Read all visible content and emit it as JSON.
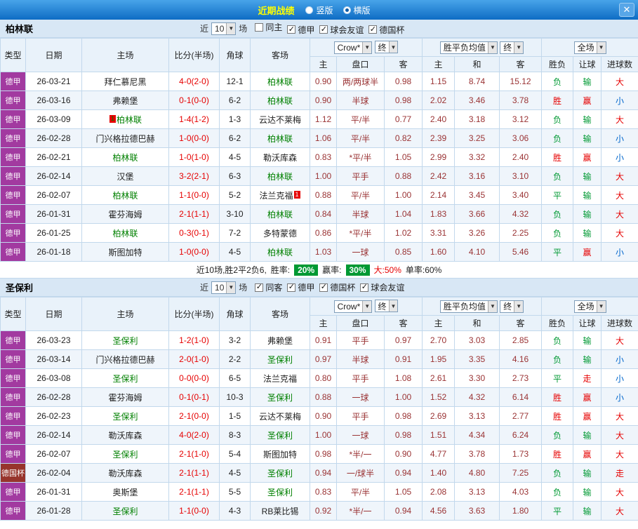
{
  "titlebar": {
    "title": "近期战绩",
    "radios": [
      {
        "label": "竖版",
        "selected": false
      },
      {
        "label": "横版",
        "selected": true
      }
    ],
    "close_label": "✕"
  },
  "table_headers": {
    "type": "类型",
    "date": "日期",
    "home": "主场",
    "score": "比分(半场)",
    "corner": "角球",
    "away": "客场",
    "sub": [
      "主",
      "盘口",
      "客",
      "主",
      "和",
      "客",
      "胜负",
      "让球",
      "进球数"
    ]
  },
  "colors": {
    "titlebar_blue": "#0e6cc4",
    "title_yellow": "#ffff00",
    "band_bg": "#d8e7f5",
    "header_bg": "#e9f2fa",
    "grid_line": "#c2d8ec",
    "league_bundesliga_bg": "#a23aa0",
    "league_dfb_pokal_bg": "#97342c",
    "focus_team_green": "#008000",
    "score_red": "#e60000",
    "odds_maroon": "#9a3334",
    "result_win_red": "#e60000",
    "result_lose_green": "#009933",
    "result_small_blue": "#0066cc",
    "rate_badge_green": "#009933"
  },
  "sections": [
    {
      "team": "柏林联",
      "filter": {
        "prefix": "近",
        "count": "10",
        "suffix": "场",
        "checkboxes": [
          {
            "label": "同主",
            "checked": false
          },
          {
            "label": "德甲",
            "checked": true
          },
          {
            "label": "球会友谊",
            "checked": true
          },
          {
            "label": "德国杯",
            "checked": true
          }
        ]
      },
      "dropdowns": [
        {
          "label": "Crow*"
        },
        {
          "label": "终"
        },
        {
          "label": "胜平负均值"
        },
        {
          "label": "终"
        },
        {
          "label": "全场"
        }
      ],
      "rows": [
        {
          "type": "德甲",
          "date": "26-03-21",
          "home": "拜仁慕尼黑",
          "home_focus": false,
          "score": "4-0(2-0)",
          "corner": "12-1",
          "away": "柏林联",
          "away_focus": true,
          "odds_home": "0.90",
          "handicap": "两/两球半",
          "odds_away": "0.98",
          "avg_home": "1.15",
          "avg_draw": "8.74",
          "avg_away": "15.12",
          "res_wdl": "负",
          "res_handicap": "输",
          "res_goals": "大"
        },
        {
          "type": "德甲",
          "date": "26-03-16",
          "home": "弗赖堡",
          "home_focus": false,
          "score": "0-1(0-0)",
          "corner": "6-2",
          "away": "柏林联",
          "away_focus": true,
          "odds_home": "0.90",
          "handicap": "半球",
          "odds_away": "0.98",
          "avg_home": "2.02",
          "avg_draw": "3.46",
          "avg_away": "3.78",
          "res_wdl": "胜",
          "res_handicap": "赢",
          "res_goals": "小"
        },
        {
          "type": "德甲",
          "date": "26-03-09",
          "home": "柏林联",
          "home_focus": true,
          "home_badge": "1",
          "score": "1-4(1-2)",
          "corner": "1-3",
          "away": "云达不莱梅",
          "away_focus": false,
          "odds_home": "1.12",
          "handicap": "平/半",
          "odds_away": "0.77",
          "avg_home": "2.40",
          "avg_draw": "3.18",
          "avg_away": "3.12",
          "res_wdl": "负",
          "res_handicap": "输",
          "res_goals": "大"
        },
        {
          "type": "德甲",
          "date": "26-02-28",
          "home": "门兴格拉德巴赫",
          "home_focus": false,
          "score": "1-0(0-0)",
          "corner": "6-2",
          "away": "柏林联",
          "away_focus": true,
          "odds_home": "1.06",
          "handicap": "平/半",
          "odds_away": "0.82",
          "avg_home": "2.39",
          "avg_draw": "3.25",
          "avg_away": "3.06",
          "res_wdl": "负",
          "res_handicap": "输",
          "res_goals": "小"
        },
        {
          "type": "德甲",
          "date": "26-02-21",
          "home": "柏林联",
          "home_focus": true,
          "score": "1-0(1-0)",
          "corner": "4-5",
          "away": "勒沃库森",
          "away_focus": false,
          "odds_home": "0.83",
          "handicap": "*平/半",
          "odds_away": "1.05",
          "avg_home": "2.99",
          "avg_draw": "3.32",
          "avg_away": "2.40",
          "res_wdl": "胜",
          "res_handicap": "赢",
          "res_goals": "小"
        },
        {
          "type": "德甲",
          "date": "26-02-14",
          "home": "汉堡",
          "home_focus": false,
          "score": "3-2(2-1)",
          "corner": "6-3",
          "away": "柏林联",
          "away_focus": true,
          "odds_home": "1.00",
          "handicap": "平手",
          "odds_away": "0.88",
          "avg_home": "2.42",
          "avg_draw": "3.16",
          "avg_away": "3.10",
          "res_wdl": "负",
          "res_handicap": "输",
          "res_goals": "大"
        },
        {
          "type": "德甲",
          "date": "26-02-07",
          "home": "柏林联",
          "home_focus": true,
          "score": "1-1(0-0)",
          "corner": "5-2",
          "away": "法兰克福",
          "away_focus": false,
          "away_badge": "1",
          "odds_home": "0.88",
          "handicap": "平/半",
          "odds_away": "1.00",
          "avg_home": "2.14",
          "avg_draw": "3.45",
          "avg_away": "3.40",
          "res_wdl": "平",
          "res_handicap": "输",
          "res_goals": "大"
        },
        {
          "type": "德甲",
          "date": "26-01-31",
          "home": "霍芬海姆",
          "home_focus": false,
          "score": "2-1(1-1)",
          "corner": "3-10",
          "away": "柏林联",
          "away_focus": true,
          "odds_home": "0.84",
          "handicap": "半球",
          "odds_away": "1.04",
          "avg_home": "1.83",
          "avg_draw": "3.66",
          "avg_away": "4.32",
          "res_wdl": "负",
          "res_handicap": "输",
          "res_goals": "大"
        },
        {
          "type": "德甲",
          "date": "26-01-25",
          "home": "柏林联",
          "home_focus": true,
          "score": "0-3(0-1)",
          "corner": "7-2",
          "away": "多特蒙德",
          "away_focus": false,
          "odds_home": "0.86",
          "handicap": "*平/半",
          "odds_away": "1.02",
          "avg_home": "3.31",
          "avg_draw": "3.26",
          "avg_away": "2.25",
          "res_wdl": "负",
          "res_handicap": "输",
          "res_goals": "大"
        },
        {
          "type": "德甲",
          "date": "26-01-18",
          "home": "斯图加特",
          "home_focus": false,
          "score": "1-0(0-0)",
          "corner": "4-5",
          "away": "柏林联",
          "away_focus": true,
          "odds_home": "1.03",
          "handicap": "一球",
          "odds_away": "0.85",
          "avg_home": "1.60",
          "avg_draw": "4.10",
          "avg_away": "5.46",
          "res_wdl": "平",
          "res_handicap": "赢",
          "res_goals": "小"
        }
      ],
      "summary": {
        "record": "近10场,胜2平2负6,",
        "win_rate_label": "胜率:",
        "win_rate": "20%",
        "asian_label": "赢率:",
        "asian_rate": "30%",
        "big_text": "大:50%",
        "single_text": "单率:60%"
      }
    },
    {
      "team": "圣保利",
      "filter": {
        "prefix": "近",
        "count": "10",
        "suffix": "场",
        "checkboxes": [
          {
            "label": "同客",
            "checked": true
          },
          {
            "label": "德甲",
            "checked": true
          },
          {
            "label": "德国杯",
            "checked": true
          },
          {
            "label": "球会友谊",
            "checked": true
          }
        ]
      },
      "dropdowns": [
        {
          "label": "Crow*"
        },
        {
          "label": "终"
        },
        {
          "label": "胜平负均值"
        },
        {
          "label": "终"
        },
        {
          "label": "全场"
        }
      ],
      "rows": [
        {
          "type": "德甲",
          "date": "26-03-23",
          "home": "圣保利",
          "home_focus": true,
          "score": "1-2(1-0)",
          "corner": "3-2",
          "away": "弗赖堡",
          "away_focus": false,
          "odds_home": "0.91",
          "handicap": "平手",
          "odds_away": "0.97",
          "avg_home": "2.70",
          "avg_draw": "3.03",
          "avg_away": "2.85",
          "res_wdl": "负",
          "res_handicap": "输",
          "res_goals": "大"
        },
        {
          "type": "德甲",
          "date": "26-03-14",
          "home": "门兴格拉德巴赫",
          "home_focus": false,
          "score": "2-0(1-0)",
          "corner": "2-2",
          "away": "圣保利",
          "away_focus": true,
          "odds_home": "0.97",
          "handicap": "半球",
          "odds_away": "0.91",
          "avg_home": "1.95",
          "avg_draw": "3.35",
          "avg_away": "4.16",
          "res_wdl": "负",
          "res_handicap": "输",
          "res_goals": "小"
        },
        {
          "type": "德甲",
          "date": "26-03-08",
          "home": "圣保利",
          "home_focus": true,
          "score": "0-0(0-0)",
          "corner": "6-5",
          "away": "法兰克福",
          "away_focus": false,
          "odds_home": "0.80",
          "handicap": "平手",
          "odds_away": "1.08",
          "avg_home": "2.61",
          "avg_draw": "3.30",
          "avg_away": "2.73",
          "res_wdl": "平",
          "res_handicap": "走",
          "res_goals": "小"
        },
        {
          "type": "德甲",
          "date": "26-02-28",
          "home": "霍芬海姆",
          "home_focus": false,
          "score": "0-1(0-1)",
          "corner": "10-3",
          "away": "圣保利",
          "away_focus": true,
          "odds_home": "0.88",
          "handicap": "一球",
          "odds_away": "1.00",
          "avg_home": "1.52",
          "avg_draw": "4.32",
          "avg_away": "6.14",
          "res_wdl": "胜",
          "res_handicap": "赢",
          "res_goals": "小"
        },
        {
          "type": "德甲",
          "date": "26-02-23",
          "home": "圣保利",
          "home_focus": true,
          "score": "2-1(0-0)",
          "corner": "1-5",
          "away": "云达不莱梅",
          "away_focus": false,
          "odds_home": "0.90",
          "handicap": "平手",
          "odds_away": "0.98",
          "avg_home": "2.69",
          "avg_draw": "3.13",
          "avg_away": "2.77",
          "res_wdl": "胜",
          "res_handicap": "赢",
          "res_goals": "大"
        },
        {
          "type": "德甲",
          "date": "26-02-14",
          "home": "勒沃库森",
          "home_focus": false,
          "score": "4-0(2-0)",
          "corner": "8-3",
          "away": "圣保利",
          "away_focus": true,
          "odds_home": "1.00",
          "handicap": "一球",
          "odds_away": "0.98",
          "avg_home": "1.51",
          "avg_draw": "4.34",
          "avg_away": "6.24",
          "res_wdl": "负",
          "res_handicap": "输",
          "res_goals": "大"
        },
        {
          "type": "德甲",
          "date": "26-02-07",
          "home": "圣保利",
          "home_focus": true,
          "score": "2-1(1-0)",
          "corner": "5-4",
          "away": "斯图加特",
          "away_focus": false,
          "odds_home": "0.98",
          "handicap": "*半/一",
          "odds_away": "0.90",
          "avg_home": "4.77",
          "avg_draw": "3.78",
          "avg_away": "1.73",
          "res_wdl": "胜",
          "res_handicap": "赢",
          "res_goals": "大"
        },
        {
          "type": "德国杯",
          "date": "26-02-04",
          "home": "勒沃库森",
          "home_focus": false,
          "score": "2-1(1-1)",
          "corner": "4-5",
          "away": "圣保利",
          "away_focus": true,
          "odds_home": "0.94",
          "handicap": "一/球半",
          "odds_away": "0.94",
          "avg_home": "1.40",
          "avg_draw": "4.80",
          "avg_away": "7.25",
          "res_wdl": "负",
          "res_handicap": "输",
          "res_goals": "走"
        },
        {
          "type": "德甲",
          "date": "26-01-31",
          "home": "奥斯堡",
          "home_focus": false,
          "score": "2-1(1-1)",
          "corner": "5-5",
          "away": "圣保利",
          "away_focus": true,
          "odds_home": "0.83",
          "handicap": "平/半",
          "odds_away": "1.05",
          "avg_home": "2.08",
          "avg_draw": "3.13",
          "avg_away": "4.03",
          "res_wdl": "负",
          "res_handicap": "输",
          "res_goals": "大"
        },
        {
          "type": "德甲",
          "date": "26-01-28",
          "home": "圣保利",
          "home_focus": true,
          "score": "1-1(0-0)",
          "corner": "4-3",
          "away": "RB莱比锡",
          "away_focus": false,
          "odds_home": "0.92",
          "handicap": "*半/一",
          "odds_away": "0.94",
          "avg_home": "4.56",
          "avg_draw": "3.63",
          "avg_away": "1.80",
          "res_wdl": "平",
          "res_handicap": "输",
          "res_goals": "大"
        }
      ],
      "summary": null
    }
  ]
}
